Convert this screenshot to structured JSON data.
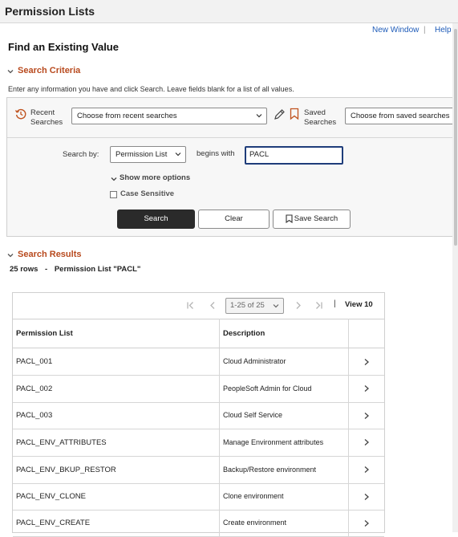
{
  "window": {
    "title": "Permission Lists"
  },
  "top_links": {
    "new_window": "New Window",
    "sep": "|",
    "help": "Help"
  },
  "page": {
    "title": "Find an Existing Value"
  },
  "search_criteria": {
    "heading": "Search Criteria",
    "hint": "Enter any information you have and click Search. Leave fields blank for a list of all values.",
    "recent": {
      "line1": "Recent",
      "line2": "Searches",
      "placeholder": "Choose from recent searches"
    },
    "saved": {
      "line1": "Saved",
      "line2": "Searches",
      "placeholder": "Choose from saved searches"
    },
    "search_by_label": "Search by:",
    "search_by_value": "Permission List",
    "operator": "begins with",
    "search_value": "PACL",
    "show_more": "Show more options",
    "case_sensitive": "Case Sensitive",
    "buttons": {
      "search": "Search",
      "clear": "Clear",
      "save": "Save Search"
    }
  },
  "search_results": {
    "heading": "Search Results",
    "summary_rows": "25 rows",
    "summary_dash": "-",
    "summary_desc": "Permission List \"PACL\"",
    "pager": {
      "range": "1-25 of 25",
      "sep": "|",
      "view": "View 10"
    },
    "columns": [
      "Permission List",
      "Description"
    ],
    "rows": [
      {
        "id": "PACL_001",
        "desc": "Cloud Administrator"
      },
      {
        "id": "PACL_002",
        "desc": "PeopleSoft Admin for Cloud"
      },
      {
        "id": "PACL_003",
        "desc": "Cloud Self Service"
      },
      {
        "id": "PACL_ENV_ATTRIBUTES",
        "desc": "Manage Environment attributes"
      },
      {
        "id": "PACL_ENV_BKUP_RESTOR",
        "desc": "Backup/Restore environment"
      },
      {
        "id": "PACL_ENV_CLONE",
        "desc": "Clone environment"
      },
      {
        "id": "PACL_ENV_CREATE",
        "desc": "Create environment"
      }
    ]
  }
}
